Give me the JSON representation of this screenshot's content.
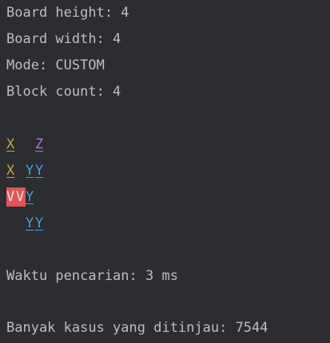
{
  "output": {
    "board_height": "Board height: 4",
    "board_width": "Board width: 4",
    "mode": "Mode: CUSTOM",
    "block_count": "Block count: 4",
    "search_time": "Waktu pencarian: 3 ms",
    "cases_checked": "Banyak kasus yang ditinjau: 7544"
  },
  "board": {
    "rows": [
      [
        {
          "char": "X",
          "color": "yellow"
        },
        {
          "char": " ",
          "color": null
        },
        {
          "char": " ",
          "color": null
        },
        {
          "char": "Z",
          "color": "purple"
        }
      ],
      [
        {
          "char": "X",
          "color": "yellow"
        },
        {
          "char": " ",
          "color": null
        },
        {
          "char": "Y",
          "color": "blue"
        },
        {
          "char": "Y",
          "color": "blue"
        }
      ],
      [
        {
          "char": "V",
          "color": "red-bg"
        },
        {
          "char": "V",
          "color": "red-bg"
        },
        {
          "char": "Y",
          "color": "blue"
        },
        {
          "char": " ",
          "color": null
        }
      ],
      [
        {
          "char": " ",
          "color": null
        },
        {
          "char": " ",
          "color": null
        },
        {
          "char": "Y",
          "color": "blue"
        },
        {
          "char": "Y",
          "color": "blue"
        }
      ]
    ]
  },
  "colors": {
    "background": "#2b2d30",
    "text": "#bcbec4",
    "yellow": "#c6a640",
    "purple": "#b577c9",
    "blue": "#4a9ed6",
    "red_bg": "#e05454"
  }
}
